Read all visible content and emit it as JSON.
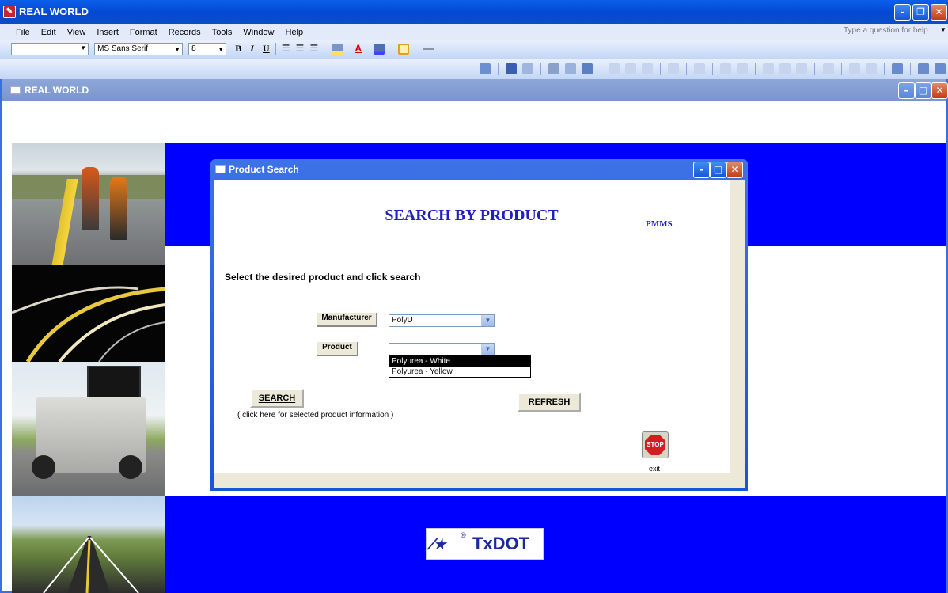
{
  "app": {
    "title": "REAL WORLD",
    "help_placeholder": "Type a question for help"
  },
  "menu": [
    "File",
    "Edit",
    "View",
    "Insert",
    "Format",
    "Records",
    "Tools",
    "Window",
    "Help"
  ],
  "format_toolbar": {
    "font": "MS Sans Serif",
    "size": "8",
    "bold": "B",
    "italic": "I",
    "underline": "U",
    "font_color": "A"
  },
  "mdi": {
    "title": "REAL WORLD"
  },
  "dialog": {
    "title": "Product Search",
    "heading": "SEARCH BY PRODUCT",
    "tag": "PMMS",
    "instruction": "Select the desired product  and click search",
    "manufacturer_label": "Manufacturer",
    "manufacturer_value": "PolyU",
    "product_label": "Product",
    "product_value": "",
    "dropdown_options": [
      "Polyurea - White",
      "Polyurea - Yellow"
    ],
    "selected_option": "Polyurea - White",
    "search_label": "SEARCH",
    "search_hint": "( click here for selected product information )",
    "refresh_label": "REFRESH",
    "stop_label": "STOP",
    "exit_label": "exit"
  },
  "footer": {
    "logo_text": "TxDOT",
    "logo_mark": "®"
  },
  "colors": {
    "brand_blue": "#0000ff",
    "xp_title": "#0a5be4",
    "heading_blue": "#2020c0"
  }
}
